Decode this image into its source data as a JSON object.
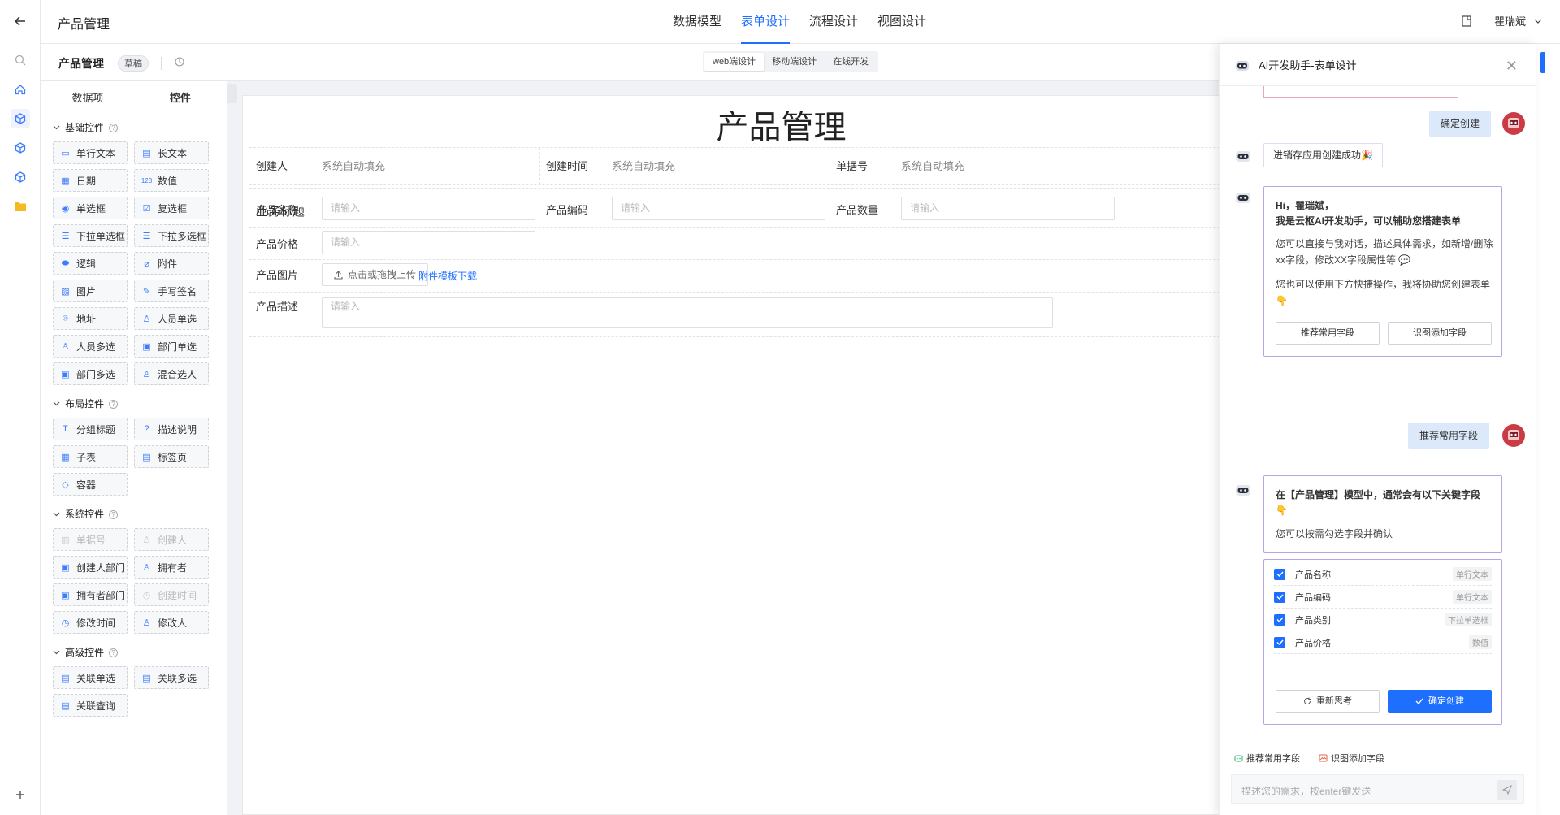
{
  "header": {
    "app_title": "产品管理",
    "tabs": [
      {
        "label": "数据模型"
      },
      {
        "label": "表单设计"
      },
      {
        "label": "流程设计"
      },
      {
        "label": "视图设计"
      }
    ],
    "active_tab": "表单设计",
    "user_name": "瞿瑞斌"
  },
  "subbar": {
    "title": "产品管理",
    "badge": "草稿",
    "modes": [
      "web端设计",
      "移动端设计",
      "在线开发"
    ],
    "active_mode": "web端设计"
  },
  "panel": {
    "tabs": [
      "数据项",
      "控件"
    ],
    "active_tab": "控件",
    "groups": [
      {
        "title": "基础控件",
        "items": [
          {
            "label": "单行文本",
            "icon": "input-icon"
          },
          {
            "label": "长文本",
            "icon": "textarea-icon"
          },
          {
            "label": "日期",
            "icon": "calendar-icon"
          },
          {
            "label": "数值",
            "icon": "number-icon"
          },
          {
            "label": "单选框",
            "icon": "radio-icon"
          },
          {
            "label": "复选框",
            "icon": "checkbox-icon"
          },
          {
            "label": "下拉单选框",
            "icon": "dropdown-icon"
          },
          {
            "label": "下拉多选框",
            "icon": "dropdown-multi-icon"
          },
          {
            "label": "逻辑",
            "icon": "toggle-icon"
          },
          {
            "label": "附件",
            "icon": "attachment-icon"
          },
          {
            "label": "图片",
            "icon": "image-icon"
          },
          {
            "label": "手写签名",
            "icon": "pen-icon"
          },
          {
            "label": "地址",
            "icon": "location-icon"
          },
          {
            "label": "人员单选",
            "icon": "user-icon"
          },
          {
            "label": "人员多选",
            "icon": "users-icon"
          },
          {
            "label": "部门单选",
            "icon": "dept-icon"
          },
          {
            "label": "部门多选",
            "icon": "dept-multi-icon"
          },
          {
            "label": "混合选人",
            "icon": "user-mix-icon"
          }
        ]
      },
      {
        "title": "布局控件",
        "items": [
          {
            "label": "分组标题",
            "icon": "title-icon"
          },
          {
            "label": "描述说明",
            "icon": "help-icon"
          },
          {
            "label": "子表",
            "icon": "table-icon"
          },
          {
            "label": "标签页",
            "icon": "tabs-icon"
          },
          {
            "label": "容器",
            "icon": "box-icon"
          }
        ]
      },
      {
        "title": "系统控件",
        "items": [
          {
            "label": "单据号",
            "icon": "barcode-icon",
            "disabled": true
          },
          {
            "label": "创建人",
            "icon": "user-icon",
            "disabled": true
          },
          {
            "label": "创建人部门",
            "icon": "dept-icon"
          },
          {
            "label": "拥有者",
            "icon": "user-icon"
          },
          {
            "label": "拥有者部门",
            "icon": "dept-icon"
          },
          {
            "label": "创建时间",
            "icon": "clock-icon",
            "disabled": true
          },
          {
            "label": "修改时间",
            "icon": "clock-icon"
          },
          {
            "label": "修改人",
            "icon": "user-icon"
          }
        ]
      },
      {
        "title": "高级控件",
        "items": [
          {
            "label": "关联单选",
            "icon": "link-form-icon"
          },
          {
            "label": "关联多选",
            "icon": "link-form-icon"
          },
          {
            "label": "关联查询",
            "icon": "link-form-icon"
          }
        ]
      }
    ]
  },
  "form": {
    "title": "产品管理",
    "system_fields": [
      {
        "label": "创建人",
        "value": "系统自动填充"
      },
      {
        "label": "创建时间",
        "value": "系统自动填充"
      },
      {
        "label": "单据号",
        "value": "系统自动填充"
      }
    ],
    "section_title": "业务标题",
    "fields": {
      "name": {
        "label": "产品名称",
        "placeholder": "请输入"
      },
      "code": {
        "label": "产品编码",
        "placeholder": "请输入"
      },
      "qty": {
        "label": "产品数量",
        "placeholder": "请输入"
      },
      "price": {
        "label": "产品价格",
        "placeholder": "请输入"
      },
      "image": {
        "label": "产品图片",
        "upload": "点击或拖拽上传",
        "template": "附件模板下载"
      },
      "desc": {
        "label": "产品描述",
        "placeholder": "请输入"
      }
    }
  },
  "ai": {
    "title": "AI开发助手-表单设计",
    "msg_confirm": "确定创建",
    "msg_success": "进销存应用创建成功🎉",
    "welcome": {
      "line1": "Hi，瞿瑞斌，",
      "line2": "我是云枢AI开发助手，可以辅助您搭建表单",
      "p1": "您可以直接与我对话，描述具体需求，如新增/删除xx字段，修改XX字段属性等 💬",
      "p2": "您也可以使用下方快捷操作，我将协助您创建表单 👇",
      "btn1": "推荐常用字段",
      "btn2": "识图添加字段"
    },
    "msg_recommend": "推荐常用字段",
    "suggest": {
      "head": "在【产品管理】模型中，通常会有以下关键字段 👇",
      "sub": "您可以按需勾选字段并确认",
      "fields": [
        {
          "name": "产品名称",
          "type": "单行文本",
          "checked": true
        },
        {
          "name": "产品编码",
          "type": "单行文本",
          "checked": true
        },
        {
          "name": "产品类别",
          "type": "下拉单选框",
          "checked": true
        },
        {
          "name": "产品价格",
          "type": "数值",
          "checked": true
        }
      ],
      "rethink": "重新思考",
      "confirm": "确定创建"
    },
    "quick": [
      "推荐常用字段",
      "识图添加字段"
    ],
    "input_placeholder": "描述您的需求，按enter键发送"
  },
  "colors": {
    "primary": "#1f6fff",
    "bubble_user": "#dbe9fb",
    "bubble_border": "#b9a4e6",
    "avatar": "#c93b45"
  }
}
